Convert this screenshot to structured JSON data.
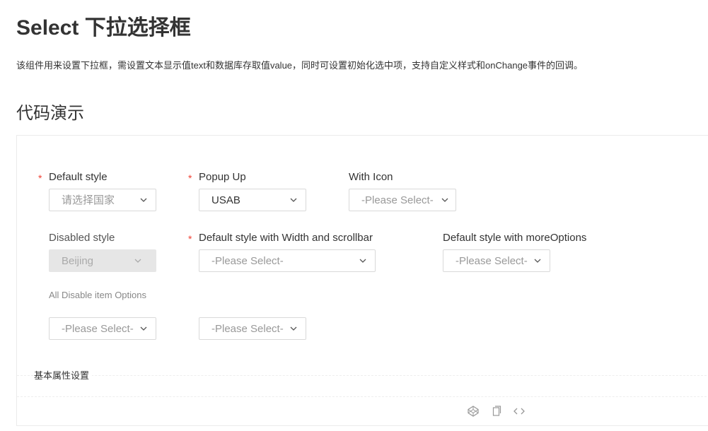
{
  "page": {
    "title": "Select 下拉选择框",
    "description": "该组件用来设置下拉框，需设置文本显示值text和数据库存取值value，同时可设置初始化选中项，支持自定义样式和onChange事件的回调。",
    "section_title": "代码演示"
  },
  "demo": {
    "fields": [
      {
        "label": "Default style",
        "value": "请选择国家",
        "required": true,
        "placeholder": true
      },
      {
        "label": "Popup Up",
        "value": "USAB",
        "required": true,
        "placeholder": false
      },
      {
        "label": "With Icon",
        "value": "-Please Select-",
        "required": false,
        "placeholder": true
      },
      {
        "label": "Disabled style",
        "value": "Beijing",
        "required": false,
        "disabled": true
      },
      {
        "label": "Default style with Width and scrollbar",
        "value": "-Please Select-",
        "required": true,
        "placeholder": true
      },
      {
        "label": "Default style with moreOptions",
        "value": "-Please Select-",
        "required": false,
        "placeholder": true
      }
    ],
    "all_disable": {
      "label": "All Disable item Options",
      "selects": [
        "-Please Select-",
        "-Please Select-"
      ]
    },
    "props_title": "基本属性设置",
    "actions": [
      "codepen-icon",
      "copy-icon",
      "code-icon"
    ]
  },
  "colors": {
    "required": "#f04134",
    "border": "#d9d9d9",
    "disabled_bg": "#e6e6e6"
  }
}
